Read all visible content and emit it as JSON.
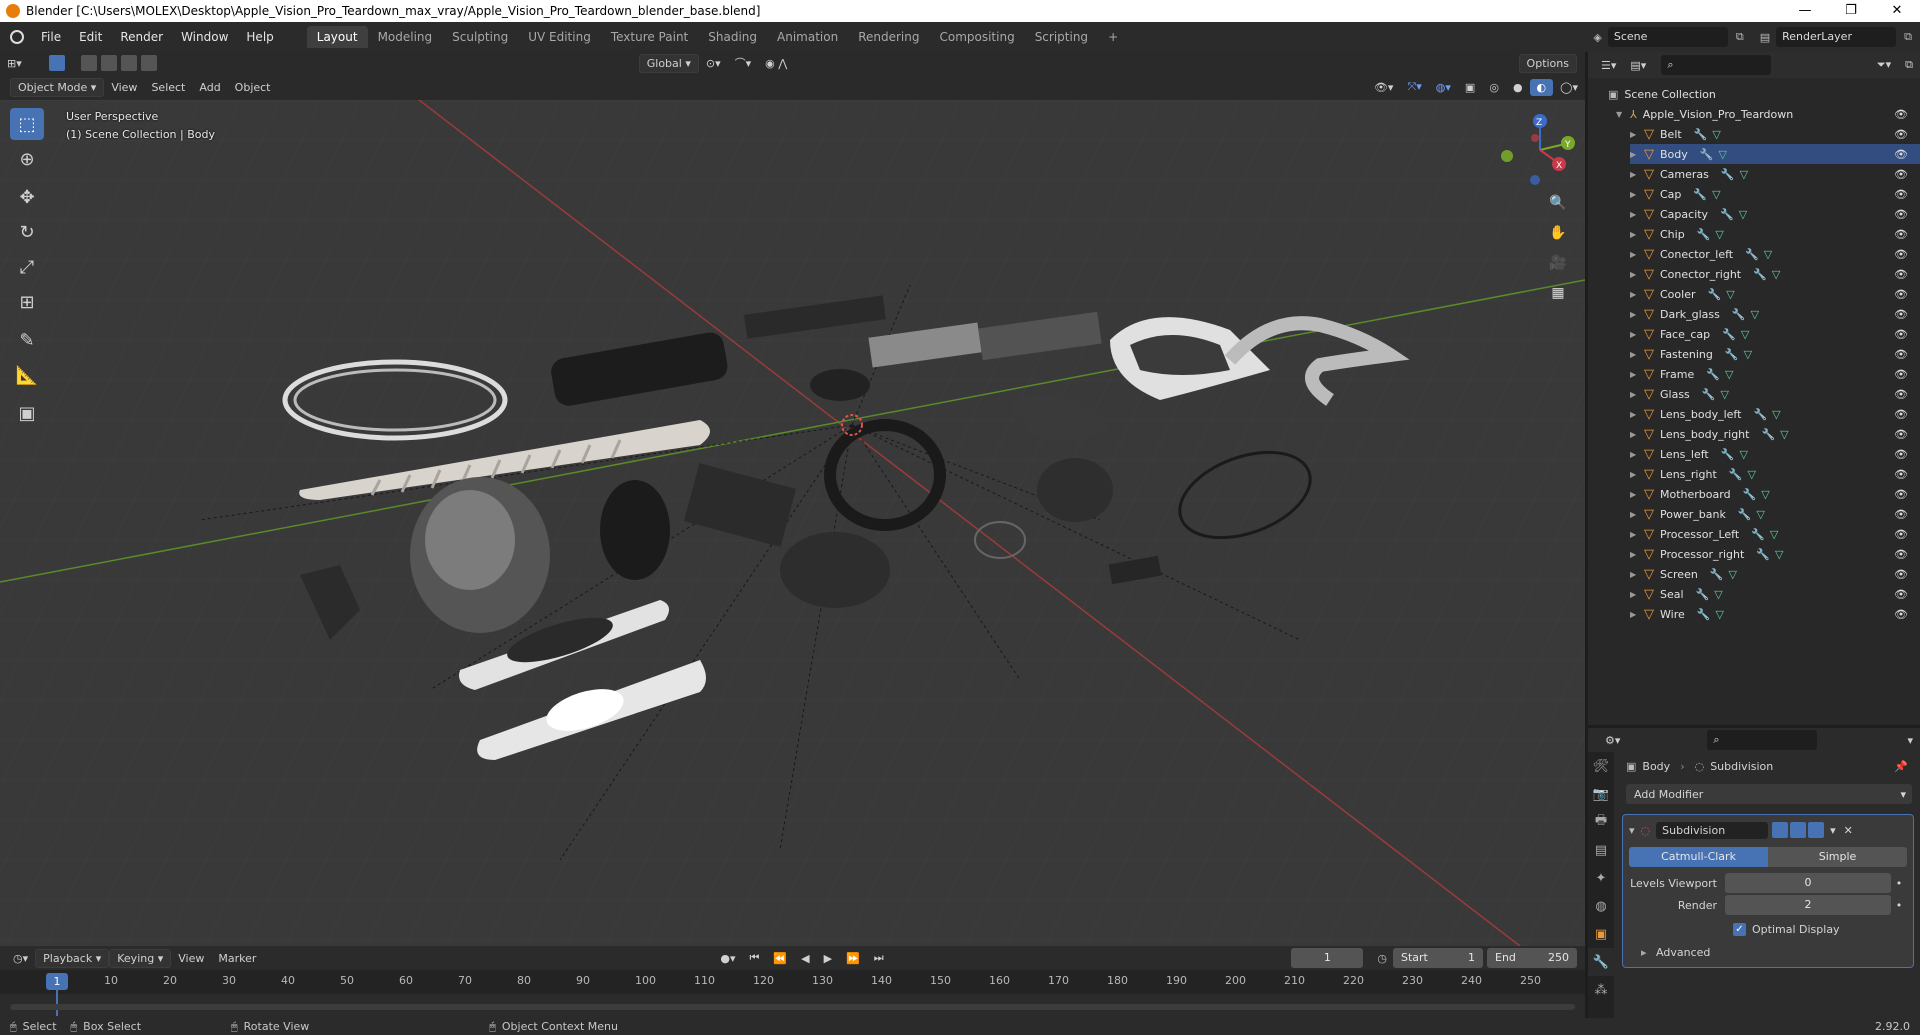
{
  "window": {
    "title": "Blender [C:\\Users\\MOLEX\\Desktop\\Apple_Vision_Pro_Teardown_max_vray/Apple_Vision_Pro_Teardown_blender_base.blend]",
    "minimize": "—",
    "maximize": "❐",
    "close": "✕"
  },
  "menu": [
    "File",
    "Edit",
    "Render",
    "Window",
    "Help"
  ],
  "workspaces": [
    "Layout",
    "Modeling",
    "Sculpting",
    "UV Editing",
    "Texture Paint",
    "Shading",
    "Animation",
    "Rendering",
    "Compositing",
    "Scripting"
  ],
  "add_workspace": "+",
  "scene": {
    "label": "Scene",
    "render_layer": "RenderLayer"
  },
  "viewport_header": {
    "orientation": "Global",
    "options": "Options",
    "mode": "Object Mode",
    "menus": [
      "View",
      "Select",
      "Add",
      "Object"
    ]
  },
  "viewport_info": {
    "line1": "User Perspective",
    "line2": "(1) Scene Collection | Body"
  },
  "gizmo": {
    "z": "Z",
    "y": "Y",
    "x": "X"
  },
  "outliner": {
    "root": "Scene Collection",
    "collection": "Apple_Vision_Pro_Teardown",
    "items": [
      "Belt",
      "Body",
      "Cameras",
      "Cap",
      "Capacity",
      "Chip",
      "Conector_left",
      "Conector_right",
      "Cooler",
      "Dark_glass",
      "Face_cap",
      "Fastening",
      "Frame",
      "Glass",
      "Lens_body_left",
      "Lens_body_right",
      "Lens_left",
      "Lens_right",
      "Motherboard",
      "Power_bank",
      "Processor_Left",
      "Processor_right",
      "Screen",
      "Seal",
      "Wire"
    ],
    "selected": "Body"
  },
  "properties": {
    "object": "Body",
    "modifier_crumb": "Subdivision",
    "add_modifier": "Add Modifier",
    "modifier_name": "Subdivision",
    "methods": [
      "Catmull-Clark",
      "Simple"
    ],
    "active_method": "Catmull-Clark",
    "levels_viewport_label": "Levels Viewport",
    "levels_viewport": "0",
    "render_label": "Render",
    "render": "2",
    "optimal_display": "Optimal Display",
    "advanced": "Advanced"
  },
  "timeline": {
    "menus": [
      "Playback",
      "Keying",
      "View",
      "Marker"
    ],
    "current_frame": "1",
    "start_label": "Start",
    "start": "1",
    "end_label": "End",
    "end": "250",
    "ticks": [
      "10",
      "20",
      "30",
      "40",
      "50",
      "60",
      "70",
      "80",
      "90",
      "100",
      "110",
      "120",
      "130",
      "140",
      "150",
      "160",
      "170",
      "180",
      "190",
      "200",
      "210",
      "220",
      "230",
      "240",
      "250"
    ],
    "playhead": "1"
  },
  "status": {
    "select": "Select",
    "box_select": "Box Select",
    "rotate_view": "Rotate View",
    "context_menu": "Object Context Menu",
    "version": "2.92.0"
  },
  "colors": {
    "accent": "#4772b3",
    "selection": "#334d80",
    "object_icon": "#e79a3a"
  }
}
